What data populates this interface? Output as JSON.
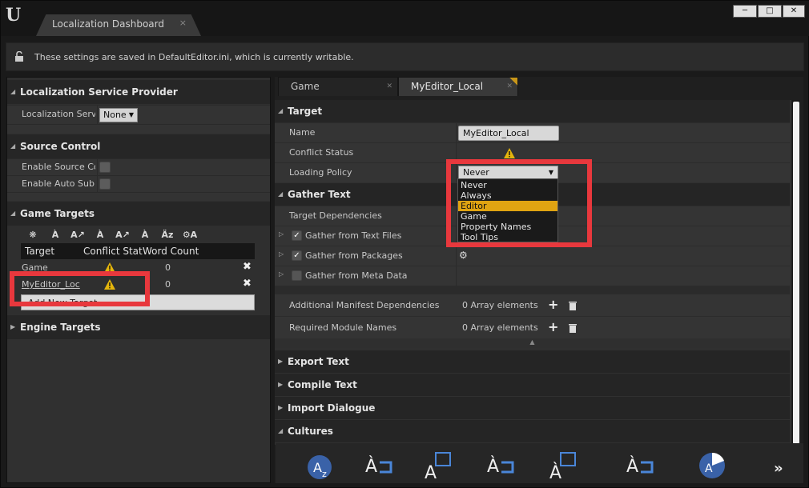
{
  "window": {
    "app_logo": "U",
    "tab_title": "Localization Dashboard",
    "tab_close": "×"
  },
  "infobar": {
    "text": "These settings are saved in DefaultEditor.ini, which is currently writable."
  },
  "left": {
    "localization_service": {
      "header": "Localization Service Provider",
      "row_label": "Localization Servi",
      "combo_value": "None"
    },
    "source_control": {
      "header": "Source Control",
      "rows": [
        "Enable Source Cor",
        "Enable Auto Subm"
      ]
    },
    "game_targets": {
      "header": "Game Targets",
      "columns": [
        "Target",
        "Conflict Stat",
        "Word Count"
      ],
      "rows": [
        {
          "target": "Game",
          "word_count": "0"
        },
        {
          "target": "MyEditor_Loc",
          "word_count": "0"
        }
      ],
      "add_button": "Add New Target"
    },
    "engine_targets": {
      "header": "Engine Targets"
    }
  },
  "right": {
    "tabs": [
      "Game",
      "MyEditor_Local"
    ],
    "target_section": {
      "header": "Target",
      "name_label": "Name",
      "name_value": "MyEditor_Local",
      "conflict_label": "Conflict Status",
      "loading_label": "Loading Policy",
      "loading_value": "Never"
    },
    "gather_section": {
      "header": "Gather Text",
      "target_deps": "Target Dependencies",
      "from_text": "Gather from Text Files",
      "from_packages": "Gather from Packages",
      "from_meta": "Gather from Meta Data",
      "manifest_deps": "Additional Manifest Dependencies",
      "manifest_value": "0 Array elements",
      "module_names": "Required Module Names",
      "module_value": "0 Array elements"
    },
    "collapsed_sections": [
      "Export Text",
      "Compile Text",
      "Import Dialogue",
      "Cultures"
    ],
    "dropdown_options": [
      "Never",
      "Always",
      "Editor",
      "Game",
      "Property Names",
      "Tool Tips"
    ],
    "dropdown_selected": "Editor"
  },
  "colors": {
    "highlight": "#e8383d",
    "selected_option": "#e0a412"
  }
}
